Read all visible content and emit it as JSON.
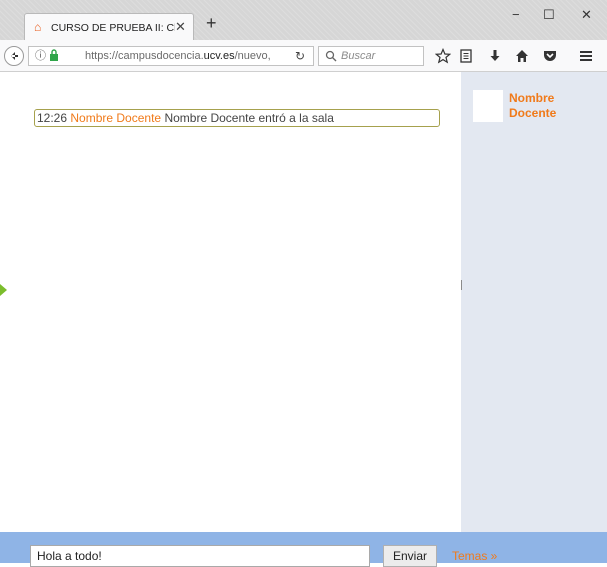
{
  "browser": {
    "tab_title": "CURSO DE PRUEBA II: Chat",
    "tab_favicon": "graduation-cap-icon",
    "new_tab_symbol": "+",
    "tab_close_symbol": "✕",
    "window_controls": {
      "minimize": "−",
      "maximize": "☐",
      "close": "✕"
    },
    "url_prefix": "https://campusdocencia.",
    "url_domain": "ucv.es",
    "url_suffix": "/nuevo,",
    "search_placeholder": "Buscar",
    "toolbar_icons": [
      "star-icon",
      "reading-list-icon",
      "download-icon",
      "home-icon",
      "pocket-icon",
      "menu-icon"
    ]
  },
  "chat": {
    "messages": [
      {
        "time": "12:26",
        "user": "Nombre Docente",
        "text": "Nombre Docente entró a la sala"
      }
    ]
  },
  "sidebar": {
    "users": [
      {
        "name": "Nombre Docente"
      }
    ]
  },
  "composer": {
    "input_value": "Hola a todo!",
    "send_label": "Enviar",
    "topics_label": "Temas »"
  },
  "colors": {
    "accent_orange": "#f07a1a",
    "footer_blue": "#8fb4e6",
    "sidebar_bg": "#e3e8f1",
    "message_border": "#a6a14d"
  }
}
